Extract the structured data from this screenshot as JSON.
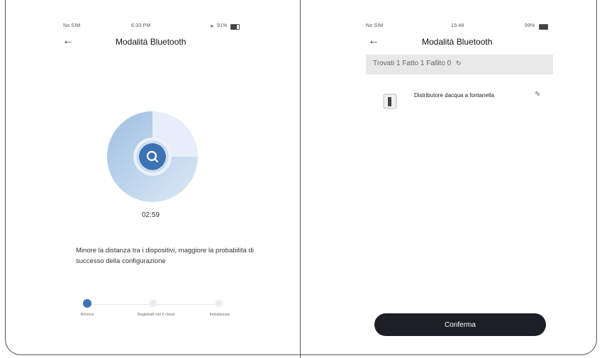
{
  "left": {
    "status": {
      "carrier": "No SIM",
      "time": "6:33 PM",
      "battery": "91%"
    },
    "title": "Modalità Bluetooth",
    "timer": "02:59",
    "hint": "Minore la distanza tra i dispositivi, maggiore la probabilità di successo della configurazione",
    "steps": [
      {
        "label": "Ricerca",
        "state": "active"
      },
      {
        "label": "Registrati con il cloud",
        "state": "pending"
      },
      {
        "label": "Inizializzare",
        "state": "pending"
      }
    ],
    "scan_progress": 0.25
  },
  "right": {
    "status": {
      "carrier": "No SIM",
      "time": "15:48",
      "battery": "99%"
    },
    "title": "Modalità Bluetooth",
    "result_summary": "Trovati 1  Fatto 1  Fallito 0",
    "device_name": "Distributore  dacqua a fontanella",
    "confirm_label": "Conferma"
  },
  "colors": {
    "accent": "#3a6fb5",
    "confirm_bg": "#1c1f26",
    "bar_bg": "#e8e8e8"
  }
}
